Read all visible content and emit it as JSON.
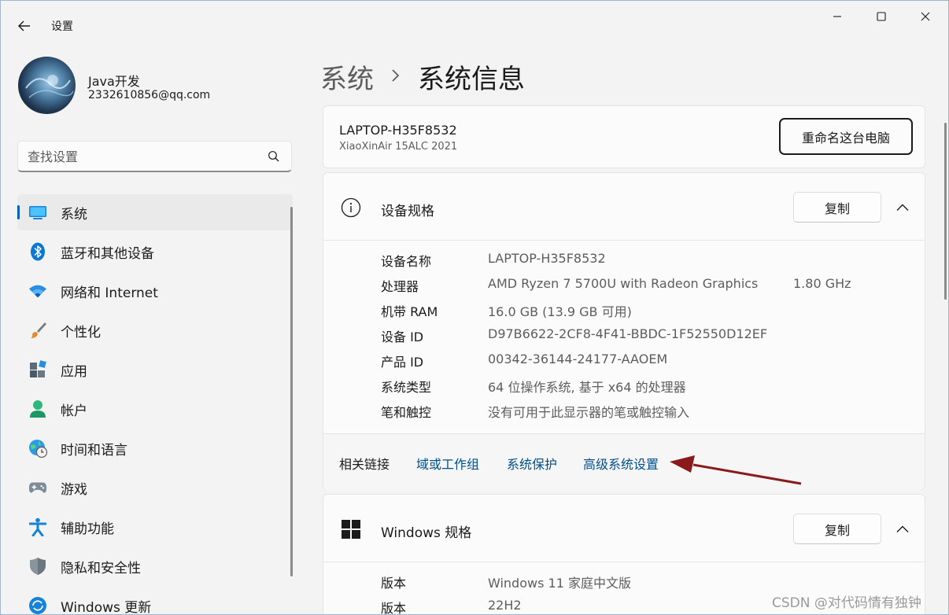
{
  "titlebar": {
    "title": "设置"
  },
  "profile": {
    "name": "Java开发",
    "email": "2332610856@qq.com"
  },
  "search": {
    "placeholder": "查找设置"
  },
  "nav": {
    "items": [
      {
        "label": "系统",
        "icon": "monitor-icon",
        "active": true
      },
      {
        "label": "蓝牙和其他设备",
        "icon": "bluetooth-icon"
      },
      {
        "label": "网络和 Internet",
        "icon": "wifi-icon"
      },
      {
        "label": "个性化",
        "icon": "brush-icon"
      },
      {
        "label": "应用",
        "icon": "apps-icon"
      },
      {
        "label": "帐户",
        "icon": "person-icon"
      },
      {
        "label": "时间和语言",
        "icon": "globe-clock-icon"
      },
      {
        "label": "游戏",
        "icon": "gamepad-icon"
      },
      {
        "label": "辅助功能",
        "icon": "accessibility-icon"
      },
      {
        "label": "隐私和安全性",
        "icon": "shield-icon"
      },
      {
        "label": "Windows 更新",
        "icon": "update-icon"
      }
    ]
  },
  "breadcrumb": {
    "parent": "系统",
    "current": "系统信息"
  },
  "pc": {
    "name": "LAPTOP-H35F8532",
    "model": "XiaoXinAir 15ALC 2021",
    "rename_label": "重命名这台电脑"
  },
  "device_specs": {
    "title": "设备规格",
    "copy_label": "复制",
    "rows": [
      {
        "label": "设备名称",
        "value": "LAPTOP-H35F8532",
        "extra": ""
      },
      {
        "label": "处理器",
        "value": "AMD Ryzen 7 5700U with Radeon Graphics",
        "extra": "1.80 GHz"
      },
      {
        "label": "机带 RAM",
        "value": "16.0 GB (13.9 GB 可用)",
        "extra": ""
      },
      {
        "label": "设备 ID",
        "value": "D97B6622-2CF8-4F41-BBDC-1F52550D12EF",
        "extra": ""
      },
      {
        "label": "产品 ID",
        "value": "00342-36144-24177-AAOEM",
        "extra": ""
      },
      {
        "label": "系统类型",
        "value": "64 位操作系统, 基于 x64 的处理器",
        "extra": ""
      },
      {
        "label": "笔和触控",
        "value": "没有可用于此显示器的笔或触控输入",
        "extra": ""
      }
    ]
  },
  "related_links": {
    "label": "相关链接",
    "links": [
      "域或工作组",
      "系统保护",
      "高级系统设置"
    ]
  },
  "windows_specs": {
    "title": "Windows 规格",
    "copy_label": "复制",
    "rows": [
      {
        "label": "版本",
        "value": "Windows 11 家庭中文版"
      },
      {
        "label": "版本",
        "value": "22H2"
      }
    ]
  },
  "watermark": "CSDN @对代码情有独钟",
  "colors": {
    "accent": "#005fb8",
    "link": "#004e8c",
    "annotation_arrow": "#8b1a1a"
  }
}
